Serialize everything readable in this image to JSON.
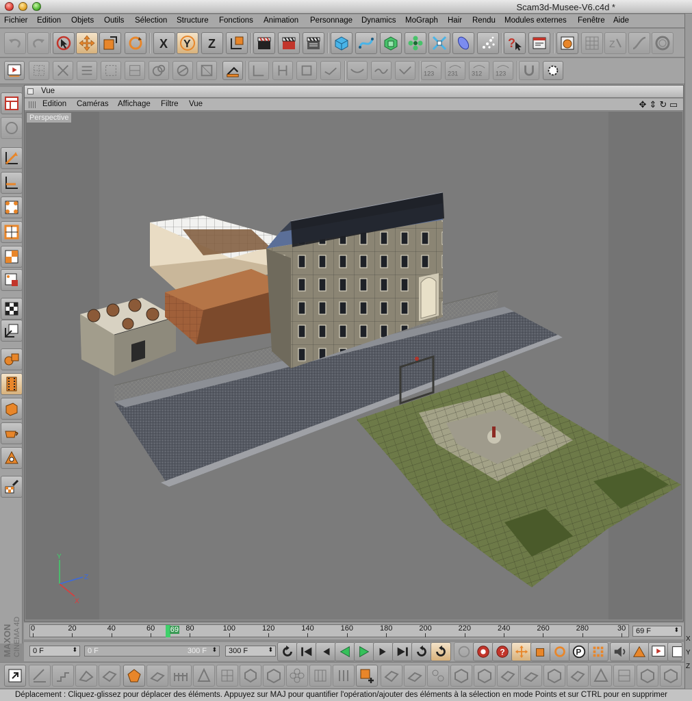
{
  "window": {
    "title": "Scam3d-Musee-V6.c4d *"
  },
  "menu": [
    "Fichier",
    "Edition",
    "Objets",
    "Outils",
    "Sélection",
    "Structure",
    "Fonctions",
    "Animation",
    "Personnage",
    "Dynamics",
    "MoGraph",
    "Hair",
    "Rendu",
    "Modules externes",
    "Fenêtre",
    "Aide"
  ],
  "toolbar1": {
    "axis_x": "X",
    "axis_y": "Y",
    "axis_z": "Z"
  },
  "toolbar2": {
    "numbers": [
      "123",
      "231",
      "312",
      "123"
    ]
  },
  "view_panel": {
    "title": "Vue",
    "menu": [
      "Edition",
      "Caméras",
      "Affichage",
      "Filtre",
      "Vue"
    ],
    "viewport_label": "Perspective",
    "axis_labels": {
      "x": "X",
      "y": "Y",
      "z": "Z"
    }
  },
  "timeline": {
    "ticks": [
      "0",
      "20",
      "40",
      "60",
      "80",
      "100",
      "120",
      "140",
      "160",
      "180",
      "200",
      "220",
      "240",
      "260",
      "280",
      "30"
    ],
    "current_frame_label": "69",
    "current_frame": 69,
    "end_field": "69 F"
  },
  "transport": {
    "start_field": "0 F",
    "range_start": "0 F",
    "range_end": "300 F",
    "end_field": "300 F"
  },
  "brand": {
    "line1": "MAXON",
    "line2": "CINEMA 4D"
  },
  "right_strip": [
    "X",
    "Y",
    "Z"
  ],
  "status": {
    "text": "Déplacement : Cliquez-glissez pour déplacer des éléments. Appuyez sur MAJ pour quantifier l'opération/ajouter des éléments à la sélection en mode Points et sur CTRL pour en supprimer"
  },
  "colors": {
    "ui_gray": "#a4a4a4",
    "viewport_bg": "#7c7c7c",
    "timeline_cursor": "#3fd06a",
    "accent_orange": "#e8862a"
  }
}
